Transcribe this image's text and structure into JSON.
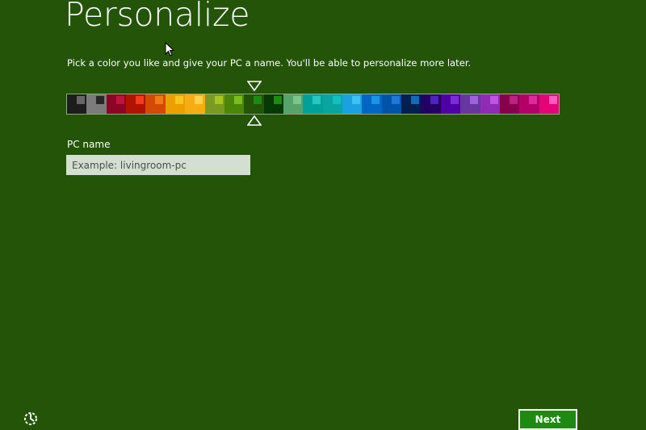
{
  "page": {
    "title": "Personalize",
    "subtitle": "Pick a color you like and give your PC a name. You'll be able to personalize more later."
  },
  "colors": {
    "background": "#235407",
    "accent_button": "#1e8a12",
    "input_background": "#d3dfd0"
  },
  "color_picker": {
    "selected_index": 9,
    "swatches": [
      {
        "bg": "#1d1d1d",
        "accent": "#666666"
      },
      {
        "bg": "#7b7b7b",
        "accent": "#262626"
      },
      {
        "bg": "#8c0525",
        "accent": "#c2133f"
      },
      {
        "bg": "#b01401",
        "accent": "#f53b17"
      },
      {
        "bg": "#d24a03",
        "accent": "#f07a14"
      },
      {
        "bg": "#ed9e00",
        "accent": "#f8c51c"
      },
      {
        "bg": "#f6ac14",
        "accent": "#fcd34a"
      },
      {
        "bg": "#7b9a22",
        "accent": "#a7c61c"
      },
      {
        "bg": "#4a8709",
        "accent": "#7ebc17"
      },
      {
        "bg": "#235407",
        "accent": "#1e8a12"
      },
      {
        "bg": "#063a05",
        "accent": "#1f8b12"
      },
      {
        "bg": "#56a36c",
        "accent": "#7bc58f"
      },
      {
        "bg": "#00a19b",
        "accent": "#26c7c0"
      },
      {
        "bg": "#0aa5a0",
        "accent": "#0fc1c1"
      },
      {
        "bg": "#1ba1e2",
        "accent": "#3dc2f2"
      },
      {
        "bg": "#0366c5",
        "accent": "#1a96e8"
      },
      {
        "bg": "#0054a7",
        "accent": "#2277d8"
      },
      {
        "bg": "#00204f",
        "accent": "#1569b8"
      },
      {
        "bg": "#230063",
        "accent": "#4d22c0"
      },
      {
        "bg": "#4c00a5",
        "accent": "#7d2bdb"
      },
      {
        "bg": "#68379e",
        "accent": "#a061e0"
      },
      {
        "bg": "#8e2cb6",
        "accent": "#c254e5"
      },
      {
        "bg": "#88004c",
        "accent": "#c01f84"
      },
      {
        "bg": "#b20068",
        "accent": "#e0299b"
      },
      {
        "bg": "#e30477",
        "accent": "#ff58c0"
      }
    ]
  },
  "pc_name": {
    "label": "PC name",
    "placeholder": "Example: livingroom-pc",
    "value": ""
  },
  "footer": {
    "next_label": "Next",
    "ease_of_access_icon": "ease-of-access-icon"
  }
}
